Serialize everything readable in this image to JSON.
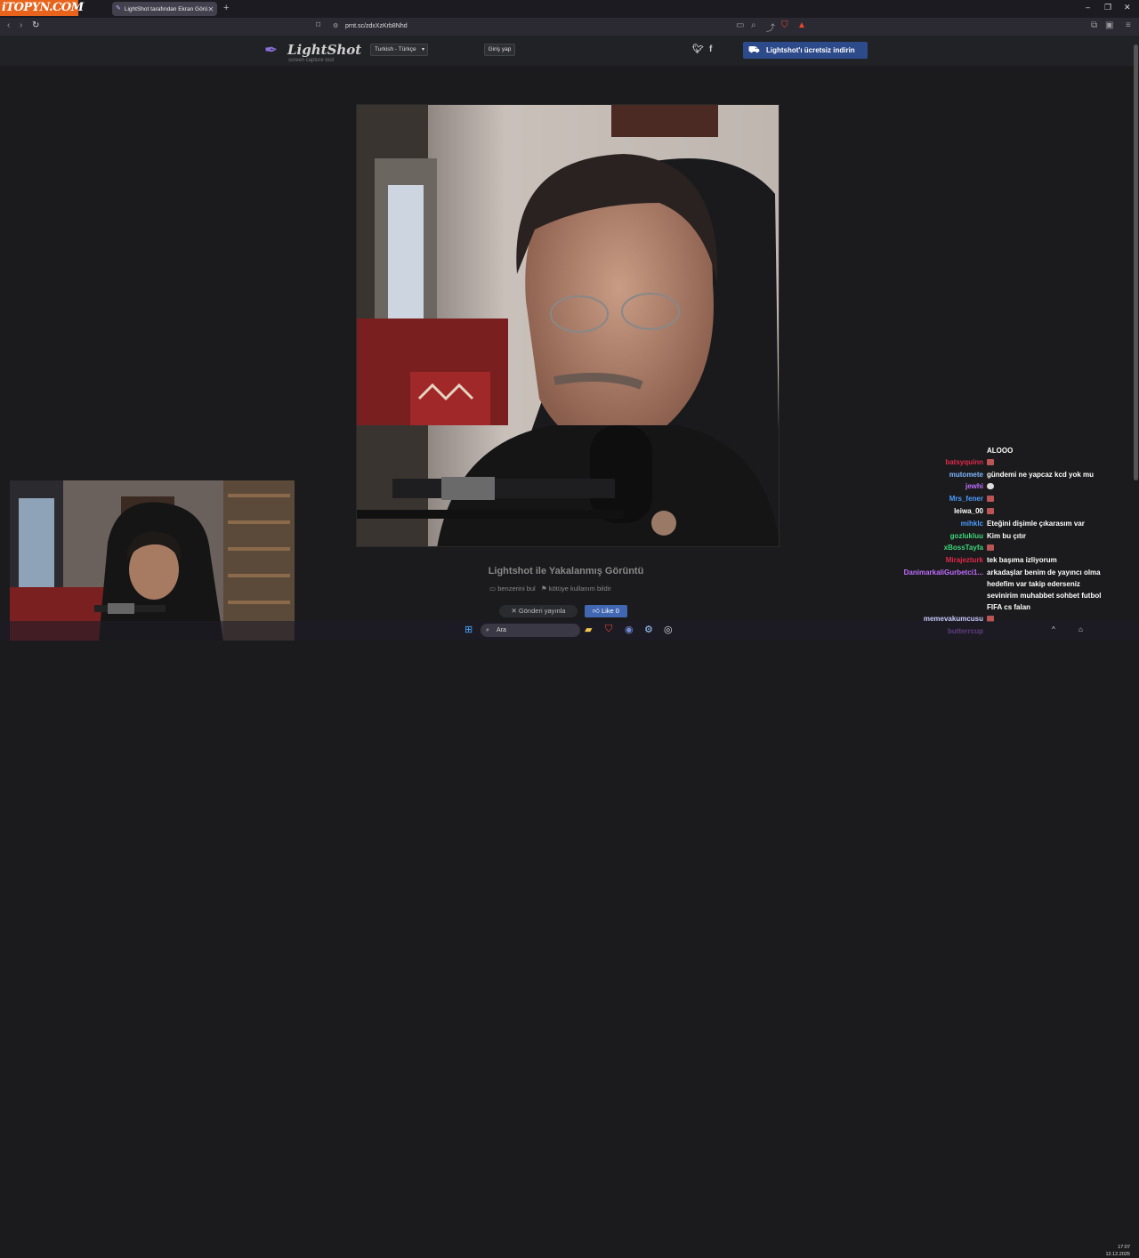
{
  "overlay": {
    "brand": "iTOPYN.COM"
  },
  "browser": {
    "tab_title": "LightShot tarafından Ekran Görü",
    "url": "prnt.sc/zdxXzKrb8Nhd",
    "new_tab": "+",
    "notif_count": "0"
  },
  "site": {
    "logo_name": "LightShot",
    "logo_sub": "screen capture tool",
    "language": "Turkish - Türkçe",
    "login": "Giriş yap",
    "download": "Lightshot'ı ücretsiz indirin",
    "twitter": "twitter-icon",
    "facebook": "facebook-icon"
  },
  "content": {
    "caption": "Lightshot ile Yakalanmış Görüntü",
    "find_similar": "benzerini bul",
    "report_abuse": "kötüye kullanım bildir",
    "share": "Gönderi yayınla",
    "like": "Like 0"
  },
  "chat": {
    "messages": [
      {
        "user": "",
        "text": "ALOOO",
        "color": "#ffffff"
      },
      {
        "user": "batsyquinn",
        "text": "",
        "emote": true,
        "color": "#e0284a"
      },
      {
        "user": "mutomete",
        "text": "gündemi ne yapcaz kcd yok mu",
        "color": "#7fb8ff"
      },
      {
        "user": "jewhi",
        "text": "",
        "emote": true,
        "color": "#c06dff"
      },
      {
        "user": "Mrs_fener",
        "text": "",
        "emote": true,
        "color": "#4a9cff"
      },
      {
        "user": "leiwa_00",
        "text": "",
        "emote": true,
        "color": "#ffffff"
      },
      {
        "user": "mihklc",
        "text": "Eteğini dişimle çıkarasım var",
        "color": "#4a9cff"
      },
      {
        "user": "gozlukluu",
        "text": "Kim bu çıtır",
        "color": "#3ed67a"
      },
      {
        "user": "xBossTayfa",
        "text": "",
        "emote": true,
        "color": "#3ed67a"
      },
      {
        "user": "Mirajezturk",
        "text": "tek başıma izliyorum",
        "color": "#e0284a"
      },
      {
        "user": "DanimarkaliGurbetci1...",
        "text": "arkadaşlar benim de yayıncı olma",
        "color": "#c06dff"
      },
      {
        "user": "",
        "text": "hedefim var takip ederseniz",
        "color": "#ffffff"
      },
      {
        "user": "",
        "text": "sevinirim muhabbet sohbet futbol",
        "color": "#ffffff"
      },
      {
        "user": "",
        "text": "FIFA cs falan",
        "color": "#ffffff"
      },
      {
        "user": "memevakumcusu",
        "text": "",
        "emote": true,
        "color": "#c9c9ff"
      },
      {
        "user": "butterrcup",
        "text": "",
        "color": "#c06dff"
      }
    ]
  },
  "taskbar": {
    "search": "Ara",
    "time": "17:07",
    "date": "12.12.2025"
  }
}
